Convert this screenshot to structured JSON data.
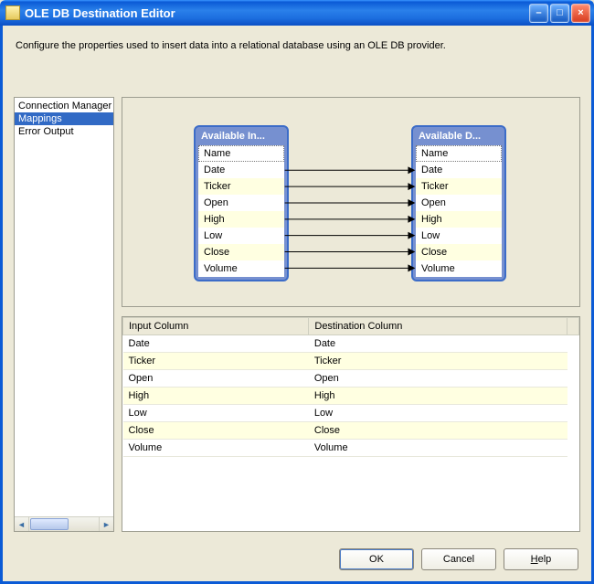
{
  "window": {
    "title": "OLE DB Destination Editor"
  },
  "description": "Configure the properties used to insert data into a relational database using an OLE DB provider.",
  "nav": {
    "items": [
      {
        "label": "Connection Manager",
        "selected": false
      },
      {
        "label": "Mappings",
        "selected": true
      },
      {
        "label": "Error Output",
        "selected": false
      }
    ]
  },
  "diagram": {
    "left_header": "Available In...",
    "right_header": "Available D...",
    "left_columns": [
      "Name",
      "Date",
      "Ticker",
      "Open",
      "High",
      "Low",
      "Close",
      "Volume"
    ],
    "right_columns": [
      "Name",
      "Date",
      "Ticker",
      "Open",
      "High",
      "Low",
      "Close",
      "Volume"
    ],
    "links": [
      "Date",
      "Ticker",
      "Open",
      "High",
      "Low",
      "Close",
      "Volume"
    ]
  },
  "grid": {
    "header_input": "Input Column",
    "header_dest": "Destination Column",
    "rows": [
      {
        "input": "Date",
        "dest": "Date"
      },
      {
        "input": "Ticker",
        "dest": "Ticker"
      },
      {
        "input": "Open",
        "dest": "Open"
      },
      {
        "input": "High",
        "dest": "High"
      },
      {
        "input": "Low",
        "dest": "Low"
      },
      {
        "input": "Close",
        "dest": "Close"
      },
      {
        "input": "Volume",
        "dest": "Volume"
      }
    ]
  },
  "buttons": {
    "ok": "OK",
    "cancel": "Cancel",
    "help": "Help"
  }
}
